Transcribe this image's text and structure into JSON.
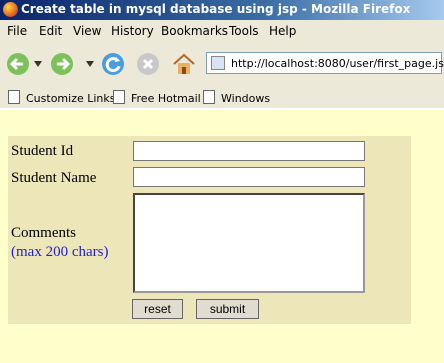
{
  "window": {
    "title": "Create table in mysql database using jsp - Mozilla Firefox"
  },
  "menu": [
    "File",
    "Edit",
    "View",
    "History",
    "Bookmarks",
    "Tools",
    "Help"
  ],
  "toolbar": {
    "url": "http://localhost:8080/user/first_page.jsp"
  },
  "bookmarks": [
    "Customize Links",
    "Free Hotmail",
    "Windows"
  ],
  "form": {
    "student_id_label": "Student Id",
    "student_id_value": "",
    "student_name_label": "Student Name",
    "student_name_value": "",
    "comments_label": "Comments",
    "comments_hint": "(max 200 chars)",
    "comments_value": "",
    "reset_label": "reset",
    "submit_label": "submit"
  },
  "colors": {
    "page_bg": "#ffffcc",
    "form_bg": "#ece6b8",
    "hint_text": "#2222cc"
  }
}
